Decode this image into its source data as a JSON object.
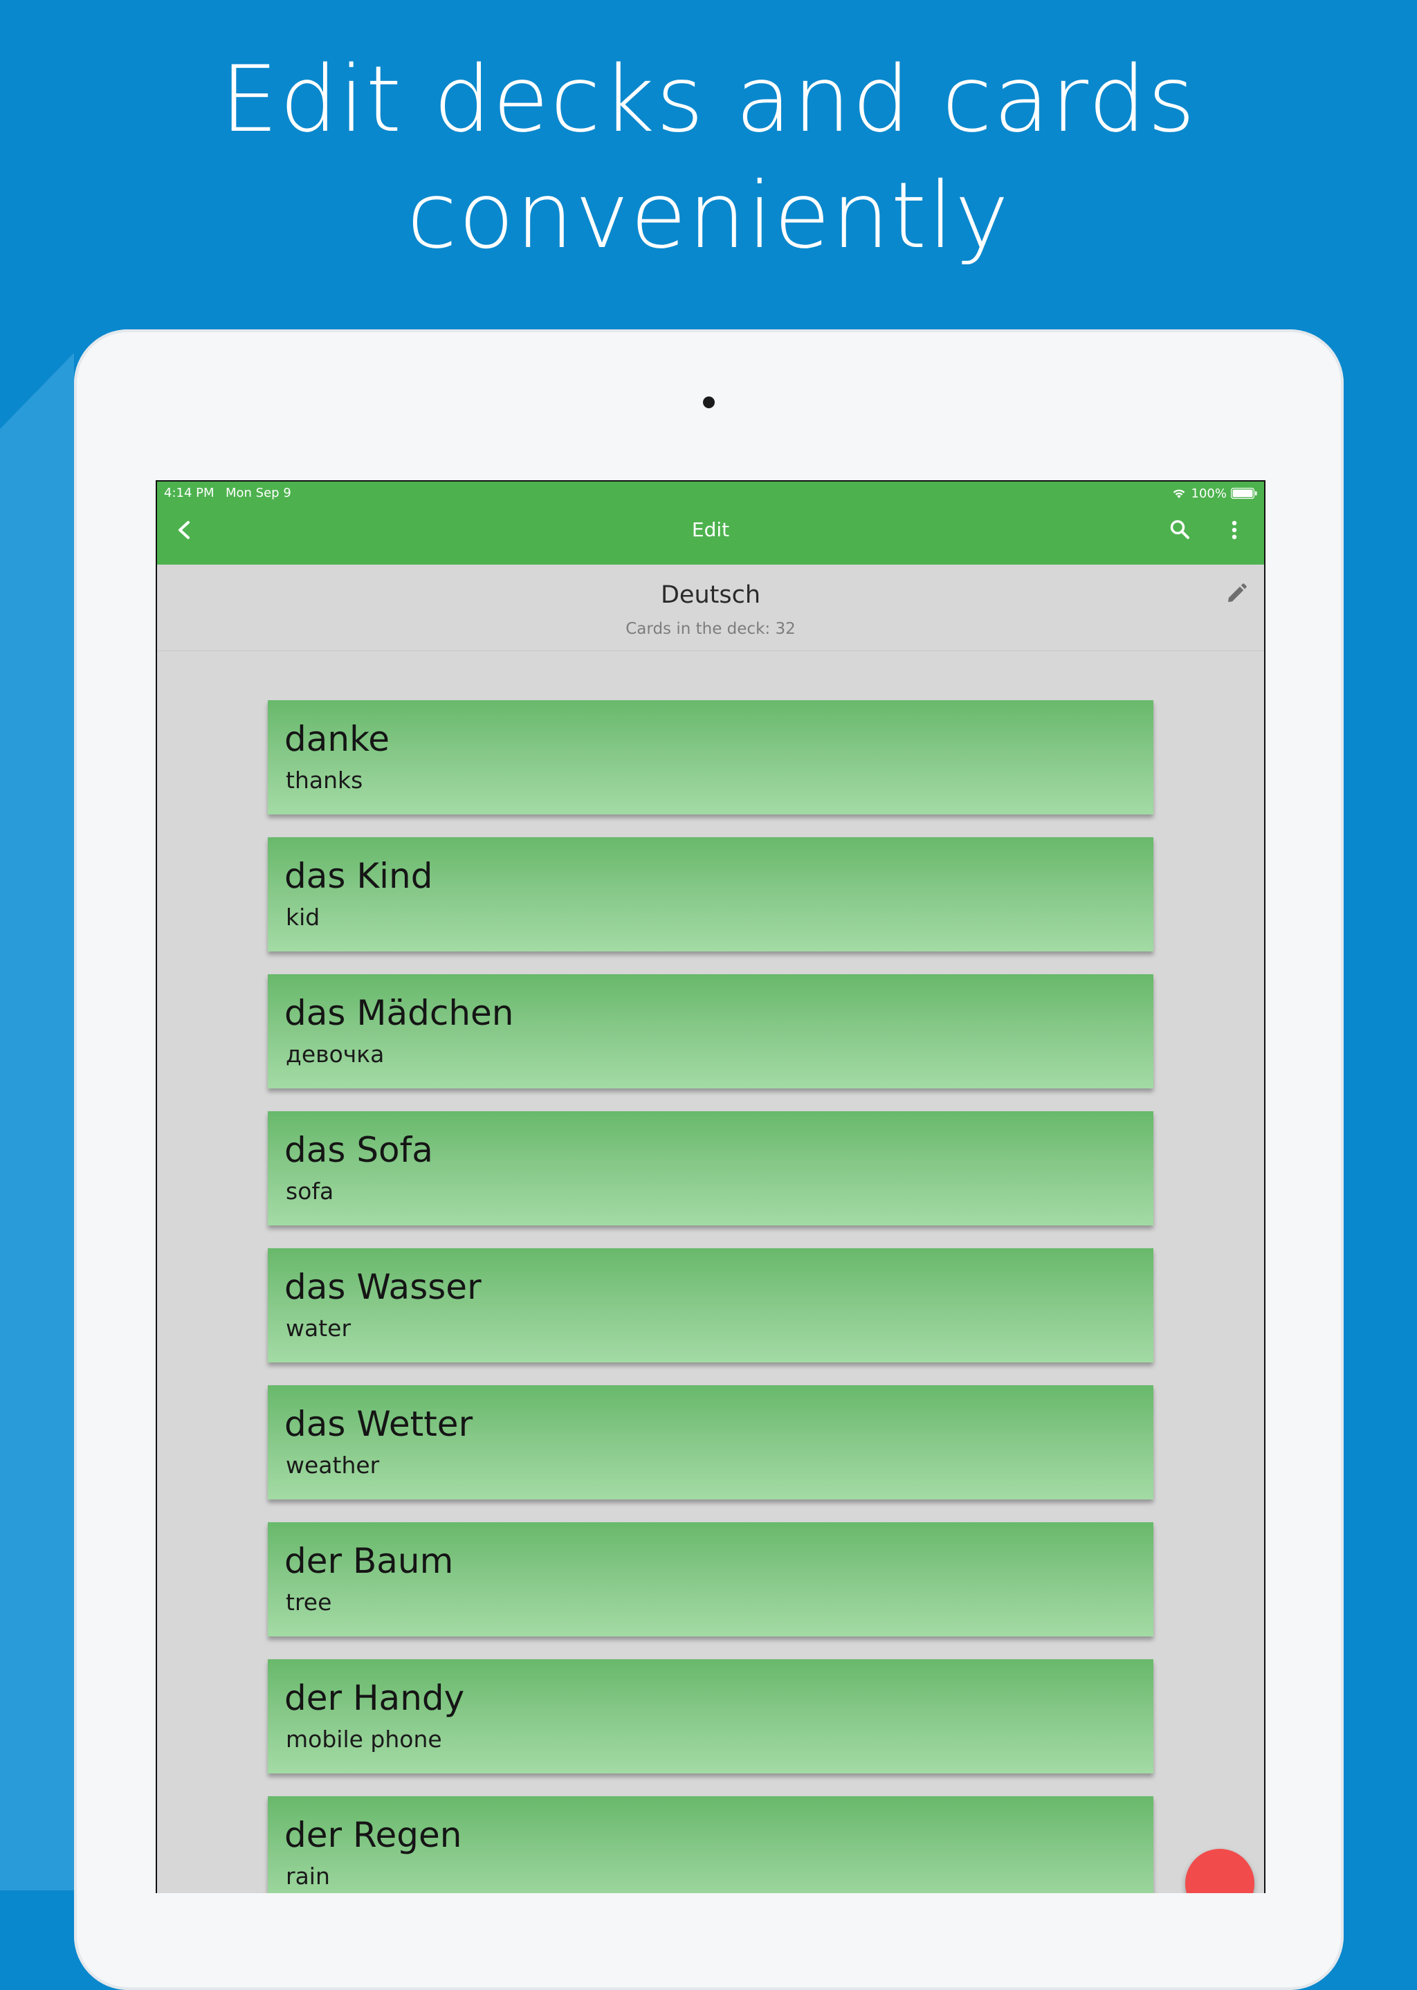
{
  "headline": {
    "line1": "Edit decks and cards",
    "line2": "conveniently"
  },
  "status_bar": {
    "time": "4:14 PM",
    "date": "Mon Sep 9",
    "battery": "100%",
    "icons": [
      "wifi-icon",
      "battery-icon"
    ]
  },
  "appbar": {
    "title": "Edit",
    "icons": [
      "back-icon",
      "search-icon",
      "more-vertical-icon"
    ]
  },
  "deck": {
    "name": "Deutsch",
    "count_text": "Cards in the deck: 32",
    "icon": "edit-pencil-icon"
  },
  "cards": [
    {
      "word": "danke",
      "translation": "thanks"
    },
    {
      "word": "das Kind",
      "translation": "kid"
    },
    {
      "word": "das Mädchen",
      "translation": "девочка"
    },
    {
      "word": "das Sofa",
      "translation": "sofa"
    },
    {
      "word": "das Wasser",
      "translation": "water"
    },
    {
      "word": "das Wetter",
      "translation": "weather"
    },
    {
      "word": "der Baum",
      "translation": "tree"
    },
    {
      "word": "der Handy",
      "translation": "mobile phone"
    },
    {
      "word": "der Regen",
      "translation": "rain"
    }
  ],
  "colors": {
    "background": "#0a88cd",
    "appbar": "#4db24e",
    "card_top": "#68b96b",
    "card_bottom": "#a3dba5",
    "fab": "#f24b4b"
  }
}
